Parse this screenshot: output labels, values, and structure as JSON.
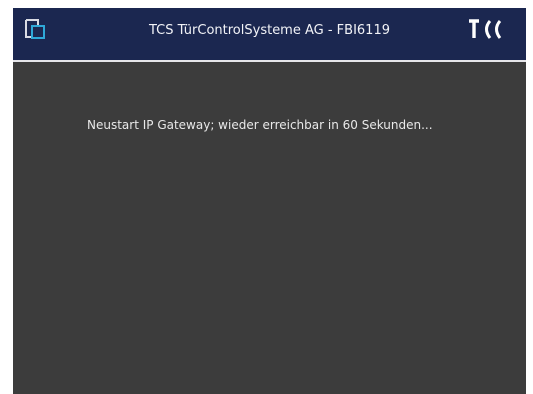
{
  "header": {
    "title": "TCS TürControlSysteme AG - FBI6119",
    "logo_text": "TCS",
    "left_icon": "window-icon",
    "background_color": "#1b2750",
    "accent_color": "#2fa8d8"
  },
  "main": {
    "message": "Neustart IP Gateway; wieder erreichbar in 60 Sekunden...",
    "background_color": "#3c3c3c"
  }
}
